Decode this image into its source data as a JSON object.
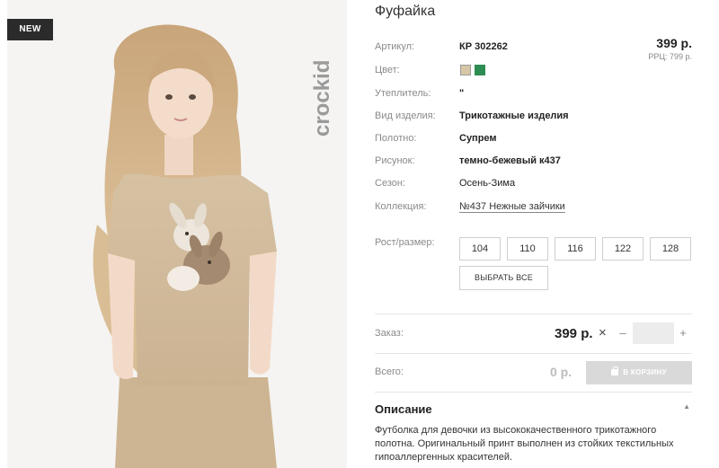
{
  "badge": {
    "label": "NEW"
  },
  "brand": {
    "logo_text": "crockid"
  },
  "product": {
    "title": "Фуфайка",
    "price": "399 р.",
    "rrp": "РРЦ: 799 р."
  },
  "attributes": [
    {
      "key": "Артикул:",
      "value": "КР 302262"
    },
    {
      "key": "Цвет:",
      "value": ""
    },
    {
      "key": "Утеплитель:",
      "value": "\""
    },
    {
      "key": "Вид изделия:",
      "value": "Трикотажные изделия"
    },
    {
      "key": "Полотно:",
      "value": "Супрем"
    },
    {
      "key": "Рисунок:",
      "value": "темно-бежевый к437"
    },
    {
      "key": "Сезон:",
      "value": "Осень-Зима"
    },
    {
      "key": "Коллекция:",
      "value": "№437 Нежные зайчики"
    }
  ],
  "colors": [
    {
      "name": "beige",
      "hex": "#d8c7a6",
      "selected": true
    },
    {
      "name": "green",
      "hex": "#2d8c52",
      "selected": false
    }
  ],
  "sizes": {
    "label": "Рост/размер:",
    "options": [
      "104",
      "110",
      "116",
      "122",
      "128"
    ],
    "select_all_label": "ВЫБРАТЬ ВСЕ"
  },
  "order": {
    "label": "Заказ:",
    "price": "399 р.",
    "times_icon": "×",
    "minus": "–",
    "plus": "+",
    "quantity": ""
  },
  "total": {
    "label": "Всего:",
    "value": "0 р.",
    "cart_label": "В КОРЗИНУ",
    "cart_icon": "shopping-bag-icon"
  },
  "description": {
    "title": "Описание",
    "text": "Футболка для девочки из высококачественного трикотажного полотна. Оригинальный принт выполнен из стойких текстильных гипоаллергенных красителей."
  },
  "theme": {
    "accent": "#2b2b2b",
    "muted": "#8a8a8a",
    "button_disabled": "#d9d9d9"
  }
}
